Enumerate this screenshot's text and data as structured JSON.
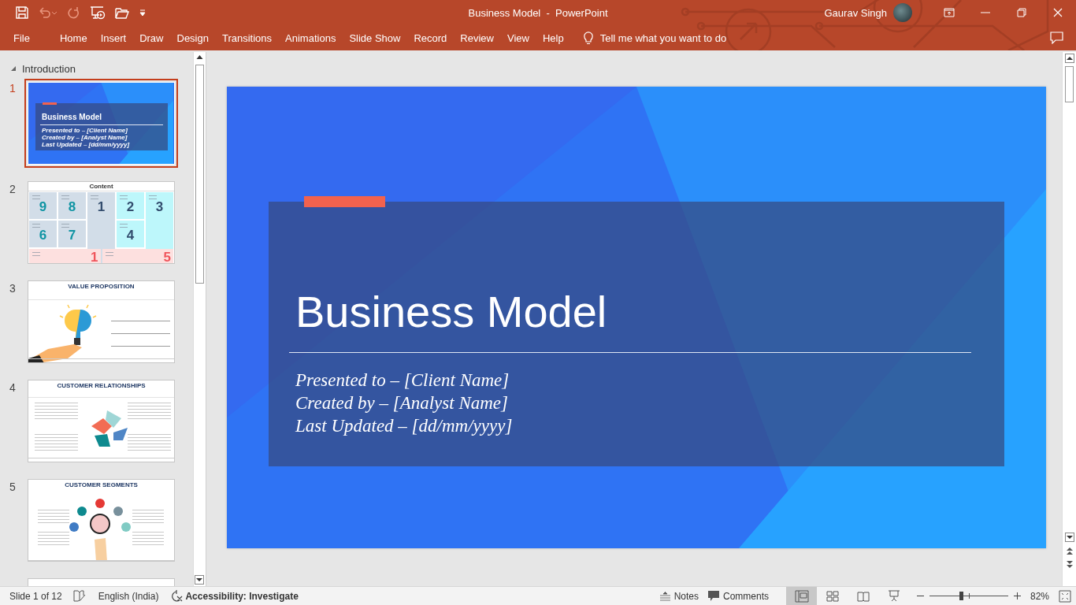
{
  "window": {
    "title": "Business Model  -  PowerPoint",
    "user": "Gaurav Singh"
  },
  "ribbon": {
    "tabs": [
      {
        "label": "File",
        "selected": false
      },
      {
        "label": "Home",
        "selected": false
      },
      {
        "label": "Insert",
        "selected": false
      },
      {
        "label": "Draw",
        "selected": false
      },
      {
        "label": "Design",
        "selected": false
      },
      {
        "label": "Transitions",
        "selected": false
      },
      {
        "label": "Animations",
        "selected": false
      },
      {
        "label": "Slide Show",
        "selected": false
      },
      {
        "label": "Record",
        "selected": false
      },
      {
        "label": "Review",
        "selected": false
      },
      {
        "label": "View",
        "selected": false
      },
      {
        "label": "Help",
        "selected": false
      }
    ],
    "tell_me": {
      "placeholder": "Tell me what you want to do"
    }
  },
  "slide_pane": {
    "section": {
      "label": "Introduction",
      "expanded": true
    },
    "slides": [
      {
        "number": "1",
        "selected": true,
        "kind": "title",
        "title": "Business Model",
        "lines": [
          "Presented to – [Client Name]",
          "Created by – [Analyst Name]",
          "Last Updated – [dd/mm/yyyy]"
        ]
      },
      {
        "number": "2",
        "selected": false,
        "kind": "grid",
        "title": "Content",
        "cells": [
          {
            "number": "9",
            "kind": "accent",
            "color": "#d2dde8"
          },
          {
            "number": "8",
            "kind": "accent",
            "color": "#d2dde8"
          },
          {
            "number": "1",
            "kind": "plain",
            "color": "#d2dde8"
          },
          {
            "number": "2",
            "kind": "plain",
            "color": "#bdf7fb"
          },
          {
            "number": "3",
            "kind": "plain",
            "color": "#bdf7fb"
          },
          {
            "number": "6",
            "kind": "accent",
            "color": "#d2dde8"
          },
          {
            "number": "7",
            "kind": "accent",
            "color": "#d2dde8"
          },
          {
            "number": "4",
            "kind": "plain",
            "color": "#bdf7fb"
          },
          {
            "number": "1",
            "kind": "alert",
            "color": "#fde0df"
          },
          {
            "number": "5",
            "kind": "alert",
            "color": "#fde0df"
          }
        ]
      },
      {
        "number": "3",
        "selected": false,
        "kind": "value",
        "title": "VALUE PROPOSITION"
      },
      {
        "number": "4",
        "selected": false,
        "kind": "relationships",
        "title": "CUSTOMER RELATIONSHIPS"
      },
      {
        "number": "5",
        "selected": false,
        "kind": "segments",
        "title": "CUSTOMER SEGMENTS"
      },
      {
        "selected": false,
        "kind": "partial"
      }
    ]
  },
  "slide": {
    "title": "Business Model",
    "lines": [
      "Presented to – [Client Name]",
      "Created by – [Analyst Name]",
      "Last Updated – [dd/mm/yyyy]"
    ]
  },
  "status_bar": {
    "slide_info": "Slide 1 of 12",
    "language": "English (India)",
    "accessibility": "Accessibility: Investigate",
    "notes": "Notes",
    "comments": "Comments",
    "views": [
      {
        "kind": "normal",
        "selected": true
      },
      {
        "kind": "sorter",
        "selected": false
      },
      {
        "kind": "reading",
        "selected": false
      },
      {
        "kind": "slideshow",
        "selected": false
      }
    ],
    "zoom": {
      "level": 0.4,
      "reading": "82%"
    }
  }
}
